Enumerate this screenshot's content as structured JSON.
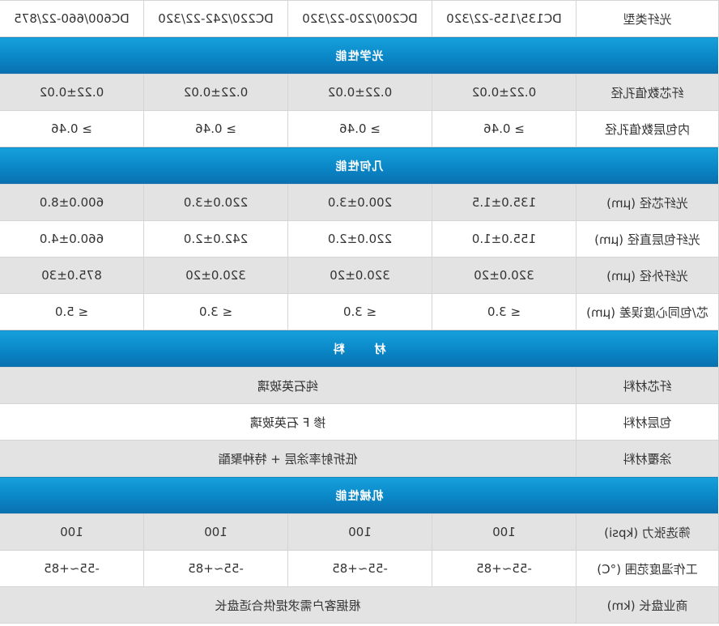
{
  "header_row": {
    "label": "光纤类型",
    "values": [
      "DC135/155-22/320",
      "DC200/220-22/320",
      "DC220/242-22/320",
      "DC600/660-22/875"
    ]
  },
  "sections": [
    {
      "title": "光学性能",
      "rows": [
        {
          "label": "纤芯数值孔径",
          "values": [
            "0.22±0.02",
            "0.22±0.02",
            "0.22±0.02",
            "0.22±0.02"
          ]
        },
        {
          "label": "内包层数值孔径",
          "values": [
            "≥ 0.46",
            "≥ 0.46",
            "≥ 0.46",
            "≥ 0.46"
          ]
        }
      ]
    },
    {
      "title": "几何性能",
      "rows": [
        {
          "label": "光纤芯径 (μm)",
          "values": [
            "135.0±1.5",
            "200.0±3.0",
            "220.0±3.0",
            "600.0±8.0"
          ]
        },
        {
          "label": "光纤包层直径 (μm)",
          "values": [
            "155.0±1.0",
            "220.0±2.0",
            "242.0±2.0",
            "660.0±4.0"
          ]
        },
        {
          "label": "光纤外径 (μm)",
          "values": [
            "320.0±20",
            "320.0±20",
            "320.0±20",
            "875.0±30"
          ]
        },
        {
          "label": "芯/包同心度误差 (μm)",
          "values": [
            "≤ 3.0",
            "≤ 3.0",
            "≤ 3.0",
            "≤ 5.0"
          ]
        }
      ]
    },
    {
      "title": "材    料",
      "rows": [
        {
          "label": "纤芯材料",
          "merged": "纯石英玻璃"
        },
        {
          "label": "包层材料",
          "merged": "掺 F 石英玻璃"
        },
        {
          "label": "涂覆材料",
          "merged": "低折射率涂层 + 特种聚酯"
        }
      ]
    },
    {
      "title": "机械性能",
      "rows": [
        {
          "label": "筛选张力 (kpsi)",
          "values": [
            "100",
            "100",
            "100",
            "100"
          ]
        },
        {
          "label": "工作温度范围 (°C)",
          "values": [
            "-55~+85",
            "-55~+85",
            "-55~+85",
            "-55~+85"
          ]
        },
        {
          "label": "商业盘长 (km)",
          "merged": "根据客户需求提供合适盘长"
        }
      ]
    }
  ]
}
